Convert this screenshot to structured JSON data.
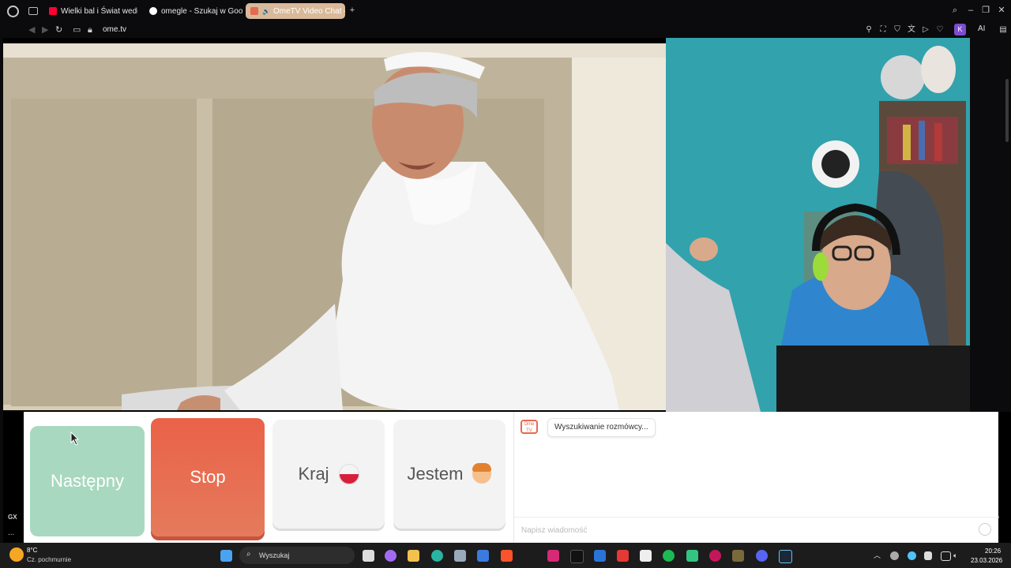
{
  "browser": {
    "tabs": [
      {
        "label": "Wielki bal i Świat według K",
        "favicon_color": "#ff0033"
      },
      {
        "label": "omegle - Szukaj w Google",
        "favicon_color": "#ffffff"
      },
      {
        "label": "OmeTV Video Chat —",
        "favicon_color": "#e46a50",
        "active": true
      }
    ],
    "url": "ome.tv",
    "profile_initial": "K",
    "ai_label": "AI"
  },
  "sidebar": {
    "gx_label": "GX",
    "more_label": "..."
  },
  "controls": {
    "next_label": "Następny",
    "stop_label": "Stop",
    "country_label": "Kraj",
    "me_label": "Jestem"
  },
  "chat": {
    "logo_text": "Ome TV",
    "status": "Wyszukiwanie rozmówcy...",
    "input_placeholder": "Napisz wiadomość"
  },
  "taskbar": {
    "weather_temp": "8°C",
    "weather_desc": "Cz. pochmurnie",
    "search_label": "Wyszukaj",
    "time": "20:26",
    "date": "23.03.2026"
  },
  "colors": {
    "accent_stop": "#ea6248",
    "next_button": "#a8d8bf",
    "active_tab": "#d9b99a"
  }
}
